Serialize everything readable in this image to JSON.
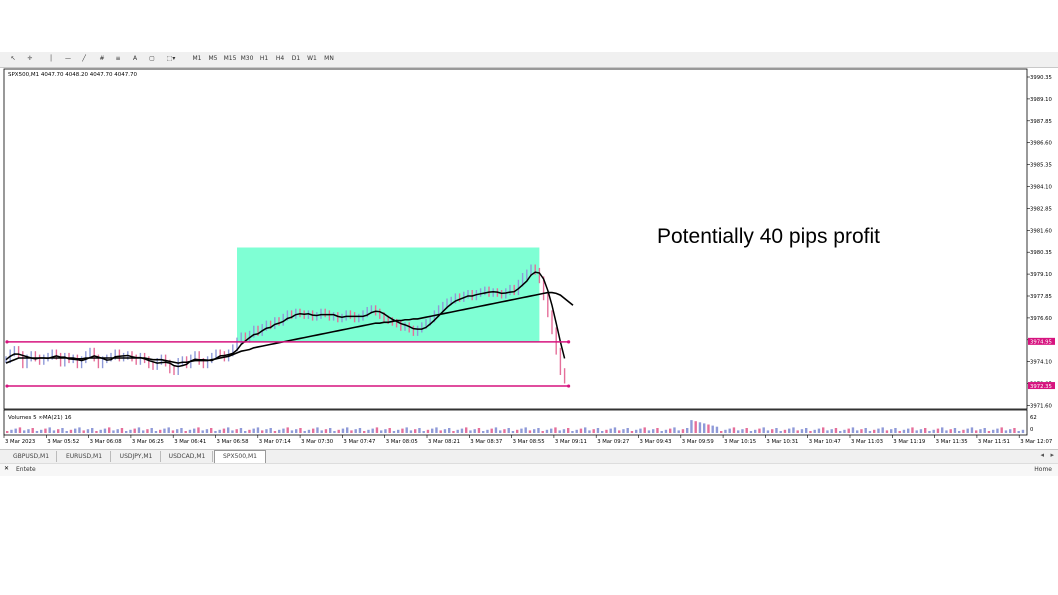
{
  "toolbar": {
    "timeframes": [
      "M1",
      "M5",
      "M15",
      "M30",
      "H1",
      "H4",
      "D1",
      "W1",
      "MN"
    ]
  },
  "chart_header": "SPX500,M1  4047.70 4048.20 4047.70 4047.70",
  "annotation": "Potentially 40 pips profit",
  "volume_header": "Volumes 5  ∞MA(21) 16",
  "price_axis": [
    "3990.35",
    "3989.10",
    "3987.85",
    "3986.60",
    "3985.35",
    "3984.10",
    "3982.85",
    "3981.60",
    "3980.35",
    "3979.10",
    "3977.85",
    "3976.60",
    "3975.35",
    "3974.10",
    "3972.85",
    "3971.60"
  ],
  "price_badges": [
    "3974.95",
    "3972.35"
  ],
  "volume_axis": [
    "62",
    "0"
  ],
  "time_axis": [
    "3 Mar 2023",
    "3 Mar 05:52",
    "3 Mar 06:08",
    "3 Mar 06:25",
    "3 Mar 06:41",
    "3 Mar 06:58",
    "3 Mar 07:14",
    "3 Mar 07:30",
    "3 Mar 07:47",
    "3 Mar 08:05",
    "3 Mar 08:21",
    "3 Mar 08:37",
    "3 Mar 08:55",
    "3 Mar 09:11",
    "3 Mar 09:27",
    "3 Mar 09:43",
    "3 Mar 09:59",
    "3 Mar 10:15",
    "3 Mar 10:31",
    "3 Mar 10:47",
    "3 Mar 11:03",
    "3 Mar 11:19",
    "3 Mar 11:35",
    "3 Mar 11:51",
    "3 Mar 12:07"
  ],
  "tabs": [
    "GBPUSD,M1",
    "EURUSD,M1",
    "USDJPY,M1",
    "USDCAD,M1",
    "SPX500,M1"
  ],
  "active_tab": 4,
  "status": {
    "left": "Entete",
    "right": "Home"
  },
  "colors": {
    "bull": "#8f9ad8",
    "bear": "#e56f9a",
    "box": "#7fffd4",
    "level": "#d6147f",
    "ma": "#000000"
  },
  "chart_data": {
    "type": "line",
    "symbol": "SPX500",
    "timeframe": "M1",
    "ylim": [
      3971.0,
      3991.0
    ],
    "levels": [
      {
        "name": "",
        "value": 3974.95
      },
      {
        "name": "",
        "value": 3972.35
      }
    ],
    "box": {
      "x_start": 55,
      "x_end": 127,
      "y_low": 3974.95,
      "y_high": 3980.5
    },
    "series": [
      {
        "name": "",
        "values": [
          3973.9,
          3974.3,
          3974.5,
          3974.2,
          3973.6,
          3974.0,
          3974.2,
          3974.0,
          3973.8,
          3974.0,
          3974.1,
          3974.3,
          3974.1,
          3973.7,
          3974.1,
          3973.9,
          3974.0,
          3973.6,
          3973.9,
          3974.2,
          3974.4,
          3974.0,
          3973.6,
          3973.9,
          3974.0,
          3974.1,
          3974.3,
          3974.0,
          3974.1,
          3974.2,
          3974.0,
          3973.8,
          3974.1,
          3973.9,
          3973.6,
          3973.5,
          3973.8,
          3974.0,
          3973.7,
          3973.3,
          3973.2,
          3973.8,
          3973.9,
          3973.6,
          3974.0,
          3974.2,
          3973.8,
          3973.6,
          3973.9,
          3974.1,
          3974.3,
          3974.2,
          3974.0,
          3974.3,
          3974.6,
          3975.0,
          3975.3,
          3975.1,
          3975.4,
          3975.7,
          3975.5,
          3975.8,
          3976.0,
          3975.9,
          3976.2,
          3976.1,
          3976.4,
          3976.6,
          3976.5,
          3976.7,
          3976.6,
          3976.5,
          3976.6,
          3976.4,
          3976.5,
          3976.7,
          3976.6,
          3976.4,
          3976.5,
          3976.3,
          3976.4,
          3976.6,
          3976.5,
          3976.3,
          3976.4,
          3976.6,
          3976.8,
          3976.9,
          3976.7,
          3976.5,
          3976.3,
          3976.2,
          3976.1,
          3976.0,
          3975.8,
          3975.9,
          3975.7,
          3975.5,
          3975.7,
          3975.9,
          3976.1,
          3976.3,
          3976.6,
          3976.9,
          3977.1,
          3977.3,
          3977.4,
          3977.6,
          3977.5,
          3977.7,
          3977.8,
          3977.6,
          3977.8,
          3977.9,
          3978.0,
          3977.8,
          3977.9,
          3977.8,
          3977.7,
          3977.9,
          3978.1,
          3977.9,
          3978.4,
          3978.8,
          3979.0,
          3979.3,
          3979.1,
          3978.6,
          3977.6,
          3976.6,
          3975.6,
          3974.4,
          3973.2,
          3972.7
        ]
      },
      {
        "name": "",
        "values": [
          3973.7,
          3973.8,
          3973.9,
          3974.0,
          3974.0,
          3974.0,
          3974.0,
          3974.0,
          3974.0,
          3974.0,
          3974.0,
          3974.0,
          3974.0,
          3974.0,
          3974.0,
          3974.0,
          3974.0,
          3973.95,
          3973.95,
          3974.0,
          3974.0,
          3974.0,
          3974.0,
          3974.0,
          3974.0,
          3974.0,
          3974.0,
          3974.0,
          3974.0,
          3974.0,
          3974.0,
          3974.0,
          3974.0,
          3974.0,
          3973.95,
          3973.9,
          3973.9,
          3973.9,
          3973.85,
          3973.8,
          3973.75,
          3973.7,
          3973.75,
          3973.75,
          3973.8,
          3973.85,
          3973.85,
          3973.85,
          3973.85,
          3973.9,
          3973.95,
          3974.0,
          3974.05,
          3974.1,
          3974.2,
          3974.3,
          3974.4,
          3974.45,
          3974.5,
          3974.6,
          3974.65,
          3974.7,
          3974.75,
          3974.8,
          3974.85,
          3974.9,
          3974.95,
          3975.0,
          3975.05,
          3975.1,
          3975.15,
          3975.2,
          3975.25,
          3975.3,
          3975.35,
          3975.4,
          3975.45,
          3975.5,
          3975.55,
          3975.6,
          3975.65,
          3975.7,
          3975.75,
          3975.8,
          3975.85,
          3975.9,
          3975.95,
          3976.0,
          3976.05,
          3976.05,
          3976.1,
          3976.1,
          3976.15,
          3976.2,
          3976.2,
          3976.25,
          3976.25,
          3976.3,
          3976.3,
          3976.35,
          3976.4,
          3976.45,
          3976.5,
          3976.55,
          3976.6,
          3976.65,
          3976.7,
          3976.75,
          3976.8,
          3976.85,
          3976.9,
          3976.95,
          3977.0,
          3977.05,
          3977.1,
          3977.15,
          3977.2,
          3977.25,
          3977.3,
          3977.35,
          3977.4,
          3977.45,
          3977.5,
          3977.55,
          3977.6,
          3977.65,
          3977.7,
          3977.75,
          3977.8,
          3977.85,
          3977.85,
          3977.8,
          3977.7,
          3977.5,
          3977.3,
          3977.1
        ]
      }
    ]
  }
}
